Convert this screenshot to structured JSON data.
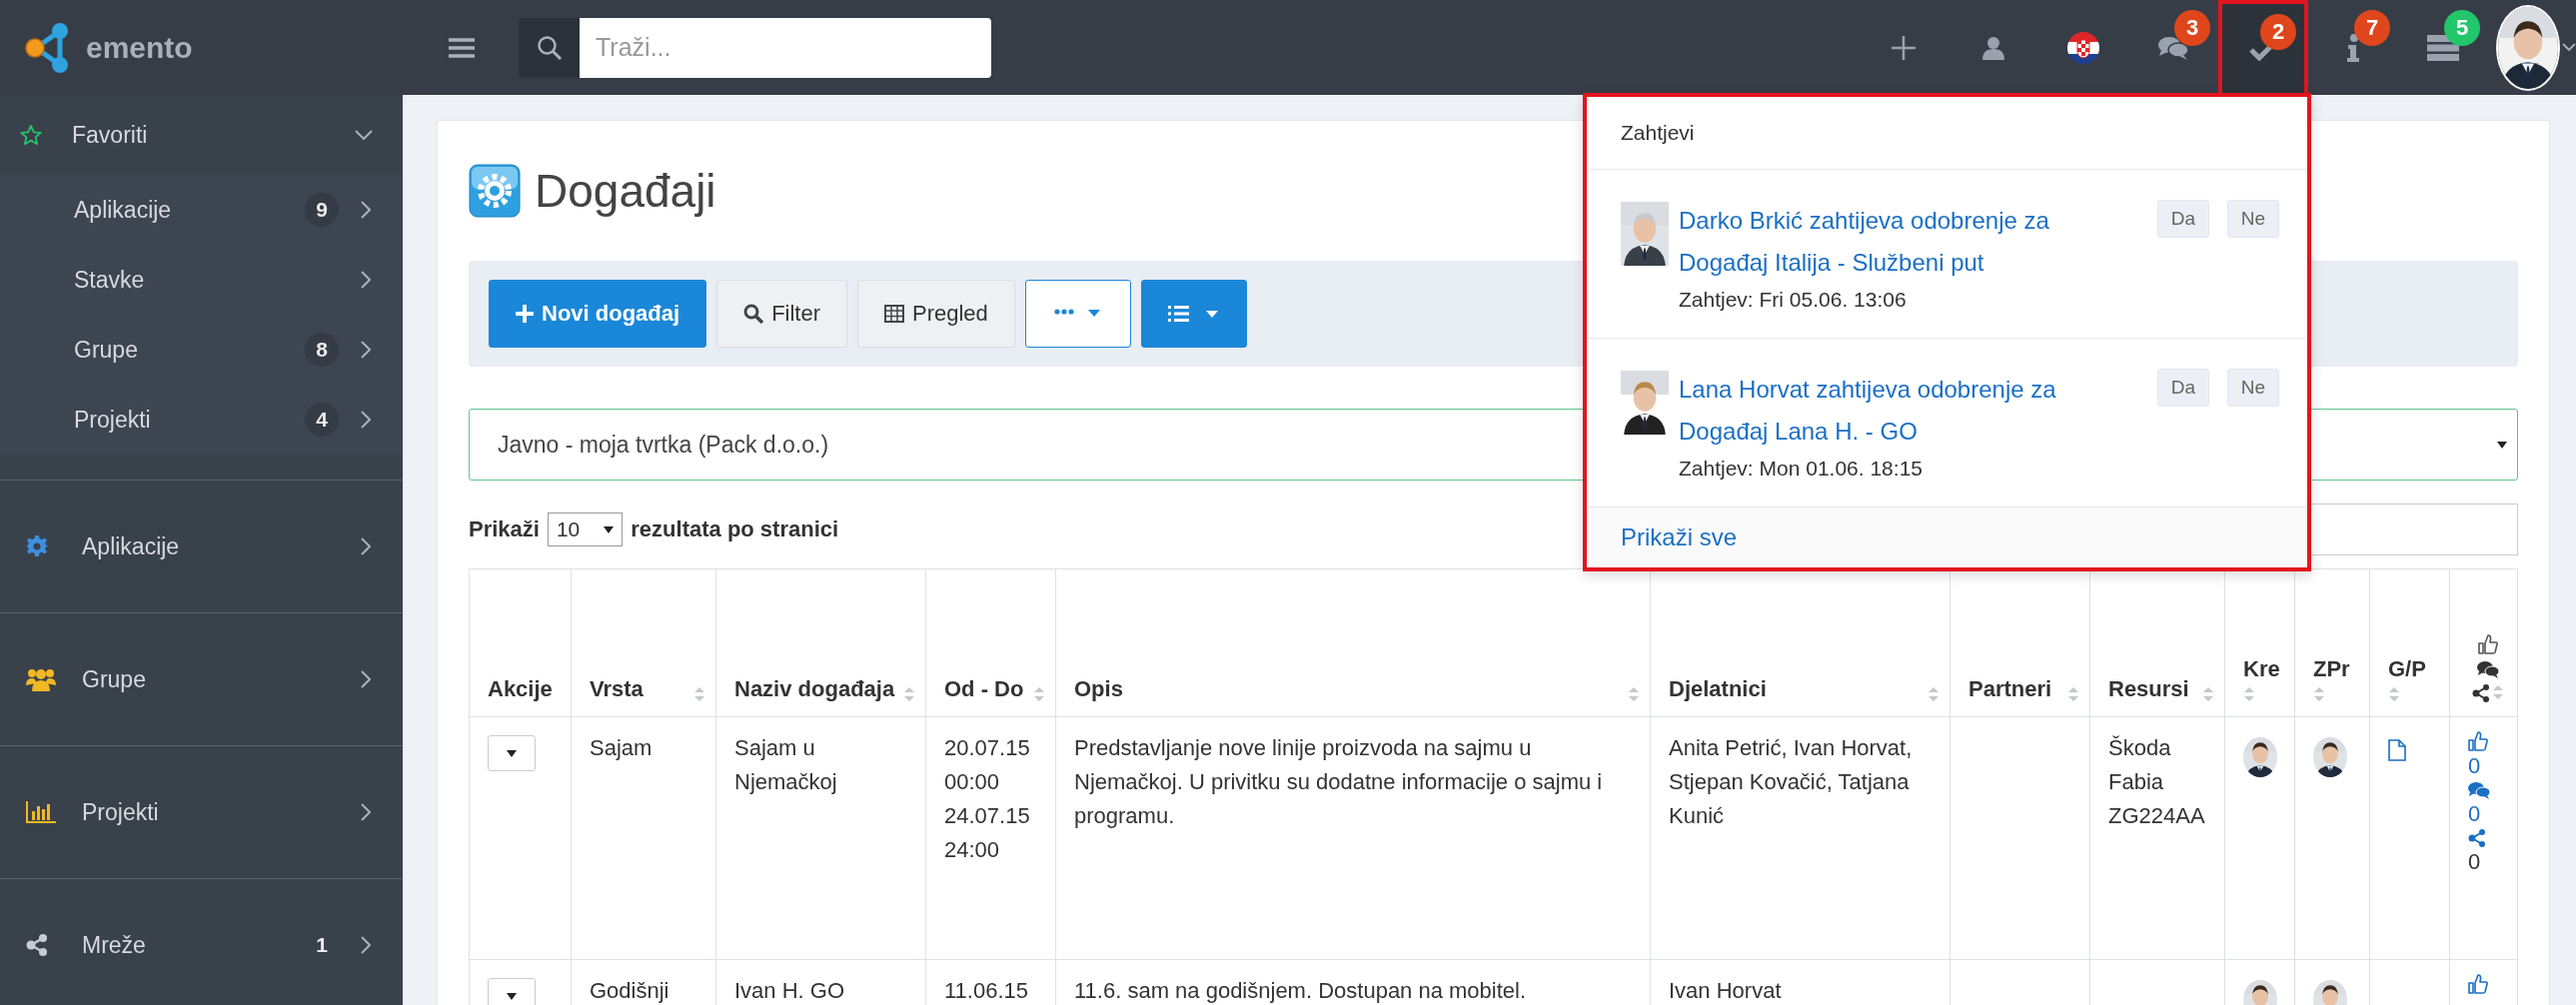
{
  "brand": {
    "name": "emento"
  },
  "search": {
    "placeholder": "Traži..."
  },
  "header_actions": [
    {
      "kind": "plus",
      "selected": false
    },
    {
      "kind": "user",
      "selected": false
    },
    {
      "kind": "flag",
      "selected": false
    },
    {
      "kind": "chat",
      "badge": "3",
      "color": "#e0461c",
      "selected": false
    },
    {
      "kind": "check",
      "badge": "2",
      "color": "#e0461c",
      "selected": true
    },
    {
      "kind": "info",
      "badge": "7",
      "color": "#e0461c",
      "selected": false
    },
    {
      "kind": "server",
      "badge": "5",
      "color": "#22c66b",
      "selected": false
    }
  ],
  "account": {
    "kind": "picture"
  },
  "sidebar": {
    "favorites": {
      "label": "Favoriti",
      "expanded": true,
      "items": [
        {
          "label": "Aplikacije",
          "count": "9"
        },
        {
          "label": "Stavke"
        },
        {
          "label": "Grupe",
          "count": "8"
        },
        {
          "label": "Projekti",
          "count": "4"
        }
      ]
    },
    "sections": [
      {
        "kind": "gear",
        "label": "Aplikacije"
      },
      {
        "kind": "users",
        "label": "Grupe"
      },
      {
        "kind": "chart",
        "label": "Projekti"
      },
      {
        "kind": "share",
        "label": "Mreže",
        "count": "1"
      }
    ]
  },
  "page": {
    "title": "Događaji"
  },
  "toolbar": [
    {
      "kind": "add",
      "label": "Novi događaj"
    },
    {
      "kind": "filter",
      "label": "Filter"
    },
    {
      "kind": "view",
      "label": "Pregled"
    },
    {
      "kind": "more"
    },
    {
      "kind": "layout"
    }
  ],
  "scope_select": {
    "value": "Javno - moja tvrtka (Pack d.o.o.)"
  },
  "paging": {
    "before": "Prikaži",
    "page_size": "10",
    "after": "rezultata po stranici"
  },
  "table": {
    "columns": [
      {
        "label": "Akcije",
        "sortable": false
      },
      {
        "label": "Vrsta",
        "sortable": true
      },
      {
        "label": "Naziv događaja",
        "sortable": true
      },
      {
        "label": "Od - Do",
        "sortable": true
      },
      {
        "label": "Opis",
        "sortable": true
      },
      {
        "label": "Djelatnici",
        "sortable": true
      },
      {
        "label": "Partneri",
        "sortable": true
      },
      {
        "label": "Resursi",
        "sortable": true
      },
      {
        "label": "Kre",
        "sortable": true
      },
      {
        "label": "ZPr",
        "sortable": true
      },
      {
        "label": "G/P",
        "sortable": true
      },
      {
        "kind": "reactions",
        "sortable": true
      }
    ],
    "rows": [
      {
        "cells": [
          {
            "kind": "actions"
          },
          {
            "kind": "text",
            "text": "Sajam"
          },
          {
            "kind": "text",
            "text": "Sajam u Njemačkoj"
          },
          {
            "kind": "text",
            "text": "20.07.15 00:00 24.07.15 24:00"
          },
          {
            "kind": "text",
            "text": "Predstavljanje nove linije proizvoda na sajmu u Njemačkoj. U privitku su dodatne informacije o sajmu i programu."
          },
          {
            "kind": "text",
            "text": "Anita Petrić, Ivan Horvat, Stjepan Kovačić, Tatjana Kunić"
          },
          {
            "kind": "empty"
          },
          {
            "kind": "text",
            "text": "Škoda Fabia ZG224AA"
          },
          {
            "kind": "picture"
          },
          {
            "kind": "picture"
          },
          {
            "kind": "file"
          },
          {
            "kind": "reactions",
            "items": [
              {
                "kind": "like",
                "count": "0"
              },
              {
                "kind": "comment",
                "count": "0"
              },
              {
                "kind": "share",
                "count": "0"
              }
            ]
          }
        ]
      },
      {
        "cells": [
          {
            "kind": "actions"
          },
          {
            "kind": "text",
            "text": "Godišnji"
          },
          {
            "kind": "text",
            "text": "Ivan H. GO"
          },
          {
            "kind": "text",
            "text": "11.06.15"
          },
          {
            "kind": "text",
            "text": "11.6. sam na godišnjem. Dostupan na mobitel."
          },
          {
            "kind": "text",
            "text": "Ivan Horvat"
          },
          {
            "kind": "empty"
          },
          {
            "kind": "empty"
          },
          {
            "kind": "picture"
          },
          {
            "kind": "picture"
          },
          {
            "kind": "empty"
          },
          {
            "kind": "reactions",
            "items": [
              {
                "kind": "like"
              }
            ]
          }
        ]
      }
    ]
  },
  "requests": {
    "title": "Zahtjevi",
    "items": [
      {
        "text": "Darko Brkić zahtijeva odobrenje za Događaj Italija - Službeni put",
        "time": "Zahtjev: Fri 05.06. 13:06",
        "accept": "Da",
        "reject": "Ne"
      },
      {
        "text": "Lana Horvat zahtijeva odobrenje za Događaj Lana H. - GO",
        "time": "Zahtjev: Mon 01.06. 18:15",
        "accept": "Da",
        "reject": "Ne"
      }
    ],
    "footer": "Prikaži sve"
  }
}
